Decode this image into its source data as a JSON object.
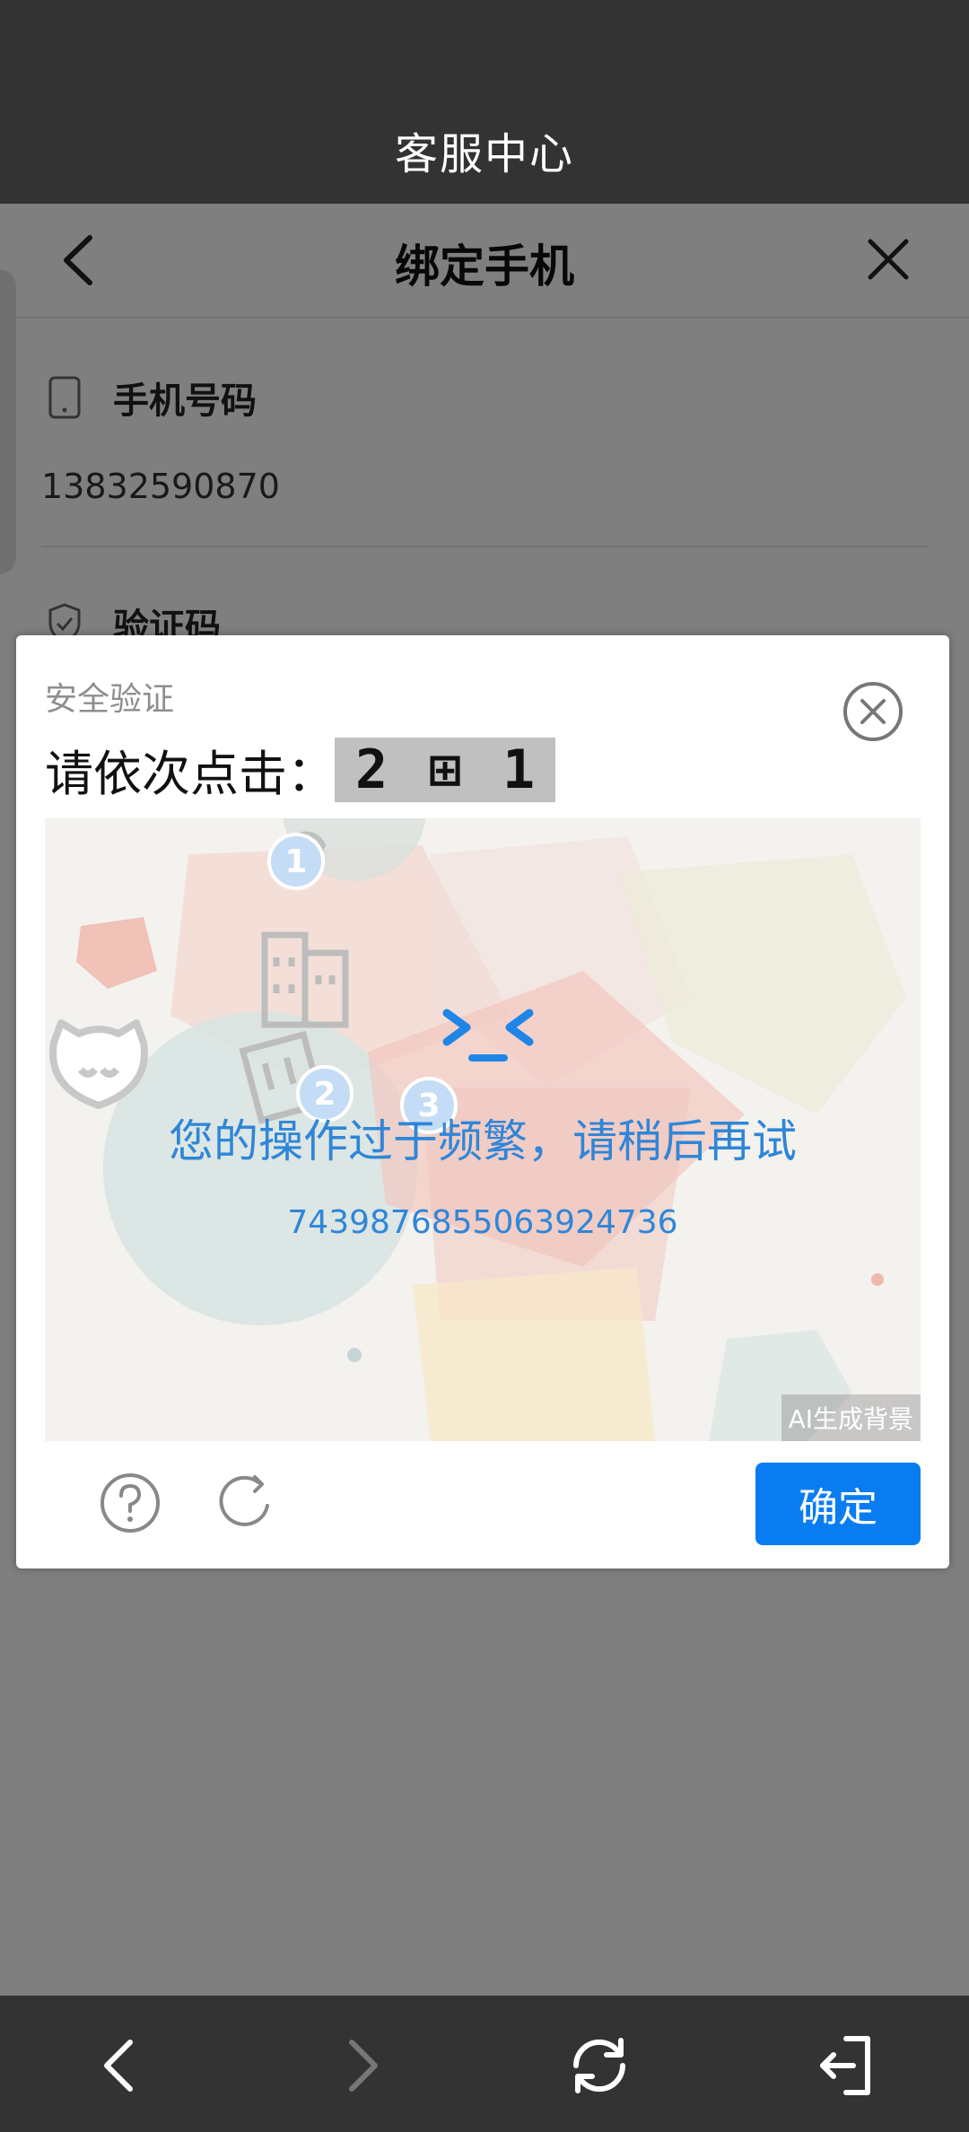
{
  "topbar": {
    "title": "客服中心"
  },
  "header": {
    "title": "绑定手机"
  },
  "form": {
    "phone_label": "手机号码",
    "phone_value": "13832590870",
    "code_label": "验证码"
  },
  "captcha": {
    "title": "安全验证",
    "instruction": "请依次点击：",
    "targets": [
      "2",
      "⊞",
      "1"
    ],
    "markers": [
      "1",
      "2",
      "3"
    ],
    "error_face": ">_<",
    "error_message": "您的操作过于频繁，请稍后再试",
    "error_code": "7439876855063924736",
    "ai_badge": "AI生成背景",
    "confirm_label": "确定",
    "accent_color": "#0a7cf2",
    "error_color": "#2f86d8"
  },
  "icons": [
    "back-icon",
    "close-icon",
    "phone-icon",
    "shield-icon",
    "close-circle-icon",
    "help-icon",
    "refresh-icon",
    "forward-icon",
    "reload-icon",
    "exit-icon"
  ]
}
